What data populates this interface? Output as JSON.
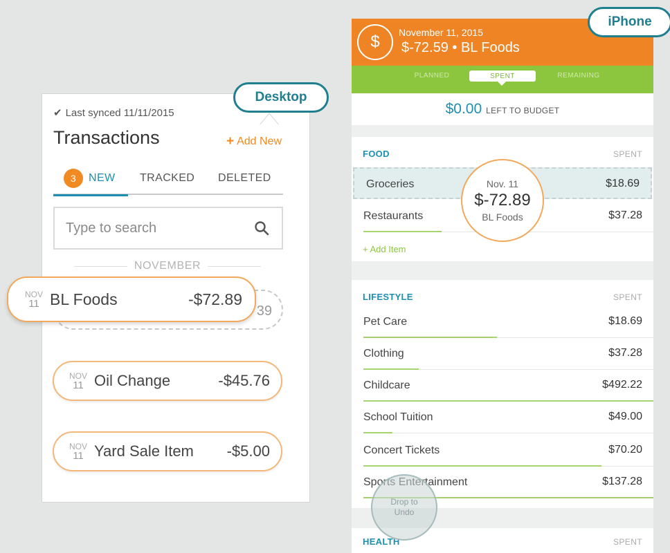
{
  "desktop": {
    "callout": "Desktop",
    "synced": "Last synced 11/11/2015",
    "title": "Transactions",
    "add_new": "Add New",
    "tabs": {
      "new_count": "3",
      "new": "NEW",
      "tracked": "TRACKED",
      "deleted": "DELETED"
    },
    "search_placeholder": "Type to search",
    "month": "NOVEMBER",
    "ghost_amount": "39",
    "transactions": [
      {
        "month": "NOV",
        "day": "11",
        "name": "BL Foods",
        "amount": "-$72.89"
      },
      {
        "month": "NOV",
        "day": "11",
        "name": "Oil Change",
        "amount": "-$45.76"
      },
      {
        "month": "NOV",
        "day": "11",
        "name": "Yard Sale Item",
        "amount": "-$5.00"
      }
    ]
  },
  "iphone": {
    "callout": "iPhone",
    "header": {
      "date": "November 11, 2015",
      "title": "$-72.59 • BL Foods",
      "icon": "dollar-icon"
    },
    "segments": {
      "planned": "PLANNED",
      "spent": "SPENT",
      "remaining": "REMAINING"
    },
    "left_to_budget": {
      "amount": "$0.00",
      "label": "LEFT TO BUDGET"
    },
    "food": {
      "heading": "FOOD",
      "spent_label": "SPENT",
      "add_item": "+ Add Item",
      "rows": [
        {
          "name": "Groceries",
          "value": "$18.69",
          "progress": 0
        },
        {
          "name": "Restaurants",
          "value": "$37.28",
          "progress": 0.27
        }
      ]
    },
    "lifestyle": {
      "heading": "LIFESTYLE",
      "spent_label": "SPENT",
      "rows": [
        {
          "name": "Pet Care",
          "value": "$18.69",
          "progress": 0.46
        },
        {
          "name": "Clothing",
          "value": "$37.28",
          "progress": 0.19
        },
        {
          "name": "Childcare",
          "value": "$492.22",
          "progress": 1.0
        },
        {
          "name": "School Tuition",
          "value": "$49.00",
          "progress": 0.1
        },
        {
          "name": "Concert Tickets",
          "value": "$70.20",
          "progress": 0.82
        },
        {
          "name": "Sports Entertainment",
          "value": "$137.28",
          "progress": 1.0
        }
      ]
    },
    "health": {
      "heading": "HEALTH",
      "spent_label": "SPENT"
    },
    "drag_circle": {
      "date": "Nov. 11",
      "amount": "$-72.89",
      "name": "BL Foods"
    },
    "undo": {
      "line1": "Drop to",
      "line2": "Undo"
    }
  },
  "colors": {
    "orange": "#ef8424",
    "green": "#8cc63f",
    "teal": "#1d8fb0",
    "callout": "#1f7f8f"
  }
}
